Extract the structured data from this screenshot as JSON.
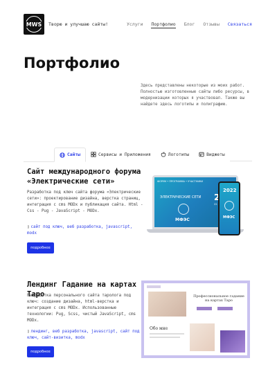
{
  "header": {
    "logo": "MWS",
    "tagline": "Творю и улучшаю сайты!",
    "nav": [
      "Услуги",
      "Портфолио",
      "Блог",
      "Отзывы"
    ],
    "contact": "Связаться"
  },
  "page": {
    "title": "Портфолио",
    "intro": "Здесь представлены некоторые из моих работ. Полностью изготовленные сайты либо ресурсы, в модернизации которых я участвовал. Также вы найдете здесь логотипы и полиграфию."
  },
  "tabs": [
    {
      "label": "Сайты",
      "icon": "globe-icon"
    },
    {
      "label": "Сервисы и Приложения",
      "icon": "grid-icon"
    },
    {
      "label": "Логотипы",
      "icon": "apple-icon"
    },
    {
      "label": "Виджеты",
      "icon": "widget-icon"
    }
  ],
  "projects": [
    {
      "title": "Сайт международного форума «Электрические сети»",
      "description": "Разработка под ключ сайта форума «Электрические сети»: проектирование дизайна, верстка страниц, интеграция с cms MODx и публикация сайта. Html - Css - Pug - JavaScript - MODx.",
      "tags": "сайт под ключ, веб разработка, javascript, modx",
      "button": "подробнее",
      "mockup": {
        "heading": "ЭЛЕКТРИЧЕСКИЕ СЕТИ",
        "year": "2022",
        "dates": "22 - 25 ноября",
        "brand": "МФЭС"
      }
    },
    {
      "title": "Лендинг Гадание на картах Таро",
      "description": "Разработка персонального сайта таролога под ключ: создание дизайна, html-верстка и интеграция с cms MODx. Использованные технологии: Pug, Scss, чистый JavaScript, cms MODx.",
      "tags": "лендинг, веб разработка, javascript, сайт под ключ, сайт-визитка, modx",
      "button": "подробнее",
      "mockup": {
        "heading": "Профессиональное гадание на картах Таро",
        "about": "Обо мне"
      }
    }
  ],
  "colors": {
    "accent": "#1d33e6",
    "link": "#2c3ee8",
    "mockup_blue": "#1e7ebd",
    "tarot_frame": "#c9c2f0"
  }
}
